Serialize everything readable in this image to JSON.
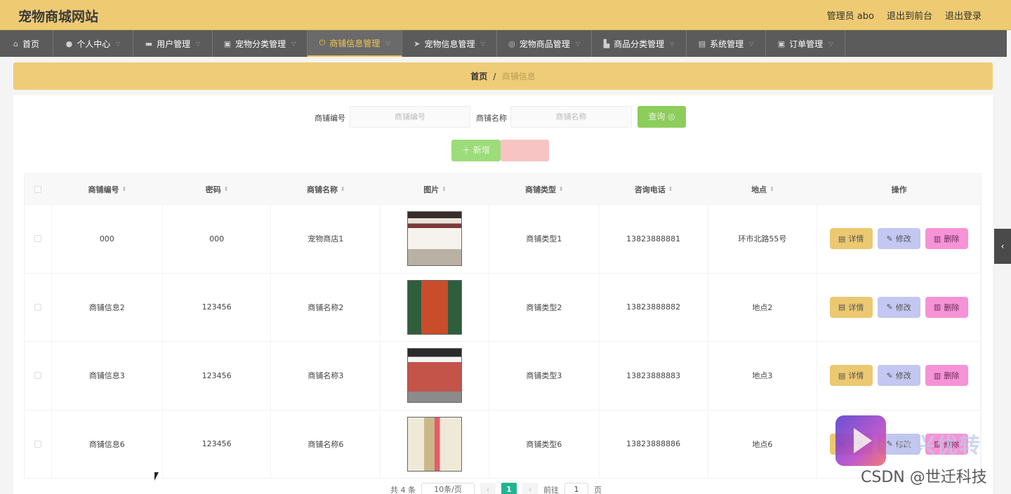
{
  "header": {
    "title": "宠物商城网站",
    "links": [
      "管理员 abo",
      "退出到前台",
      "退出登录"
    ]
  },
  "nav": [
    {
      "label": "首页",
      "icon": "home-icon",
      "glyph": "⌂",
      "w": 76,
      "active": false,
      "chev": false
    },
    {
      "label": "个人中心",
      "icon": "user-icon",
      "glyph": "●",
      "w": 114,
      "active": false,
      "chev": true
    },
    {
      "label": "用户管理",
      "icon": "briefcase-icon",
      "glyph": "▬",
      "w": 113,
      "active": false,
      "chev": true
    },
    {
      "label": "宠物分类管理",
      "icon": "clipboard-icon",
      "glyph": "▣",
      "w": 135,
      "active": false,
      "chev": true
    },
    {
      "label": "商铺信息管理",
      "icon": "power-icon",
      "glyph": "⏻",
      "w": 135,
      "active": true,
      "chev": true
    },
    {
      "label": "宠物信息管理",
      "icon": "send-icon",
      "glyph": "➤",
      "w": 135,
      "active": false,
      "chev": true
    },
    {
      "label": "宠物商品管理",
      "icon": "settings-icon",
      "glyph": "◎",
      "w": 135,
      "active": false,
      "chev": true
    },
    {
      "label": "商品分类管理",
      "icon": "truck-icon",
      "glyph": "▙",
      "w": 135,
      "active": false,
      "chev": true
    },
    {
      "label": "系统管理",
      "icon": "server-icon",
      "glyph": "▤",
      "w": 113,
      "active": false,
      "chev": true
    },
    {
      "label": "订单管理",
      "icon": "clipboard-icon",
      "glyph": "▣",
      "w": 113,
      "active": false,
      "chev": true
    }
  ],
  "breadcrumb": {
    "home": "首页",
    "sep": "/",
    "current": "商铺信息"
  },
  "search": {
    "label1": "商铺编号",
    "placeholder1": "商铺编号",
    "label2": "商铺名称",
    "placeholder2": "商铺名称",
    "query": "查询 ◎"
  },
  "actions": {
    "add": "＋ 新增"
  },
  "table": {
    "headers": [
      "商铺编号",
      "密码",
      "商铺名称",
      "图片",
      "商铺类型",
      "咨询电话",
      "地点",
      "操作"
    ],
    "rows": [
      {
        "id": "000",
        "pwd": "000",
        "name": "宠物商店1",
        "type": "商铺类型1",
        "phone": "13823888881",
        "place": "环市北路55号"
      },
      {
        "id": "商铺信息2",
        "pwd": "123456",
        "name": "商铺名称2",
        "type": "商铺类型2",
        "phone": "13823888882",
        "place": "地点2"
      },
      {
        "id": "商铺信息3",
        "pwd": "123456",
        "name": "商铺名称3",
        "type": "商铺类型3",
        "phone": "13823888883",
        "place": "地点3"
      },
      {
        "id": "商铺信息6",
        "pwd": "123456",
        "name": "商铺名称6",
        "type": "商铺类型6",
        "phone": "13823888886",
        "place": "地点6"
      }
    ],
    "btn_detail": "详情",
    "btn_edit": "修改",
    "btn_delete": "删除"
  },
  "pagination": {
    "total": "共 4 条",
    "size": "10条/页",
    "current": "1",
    "goto": "前往",
    "page_input": "1",
    "page_unit": "页"
  },
  "watermark": {
    "brand": "万兴优转",
    "csdn": "CSDN @世迁科技"
  },
  "colors": {
    "header": "#eecb72",
    "nav": "#5b5b5b",
    "accent": "#f0c64e",
    "page_active": "#1fb58f"
  }
}
